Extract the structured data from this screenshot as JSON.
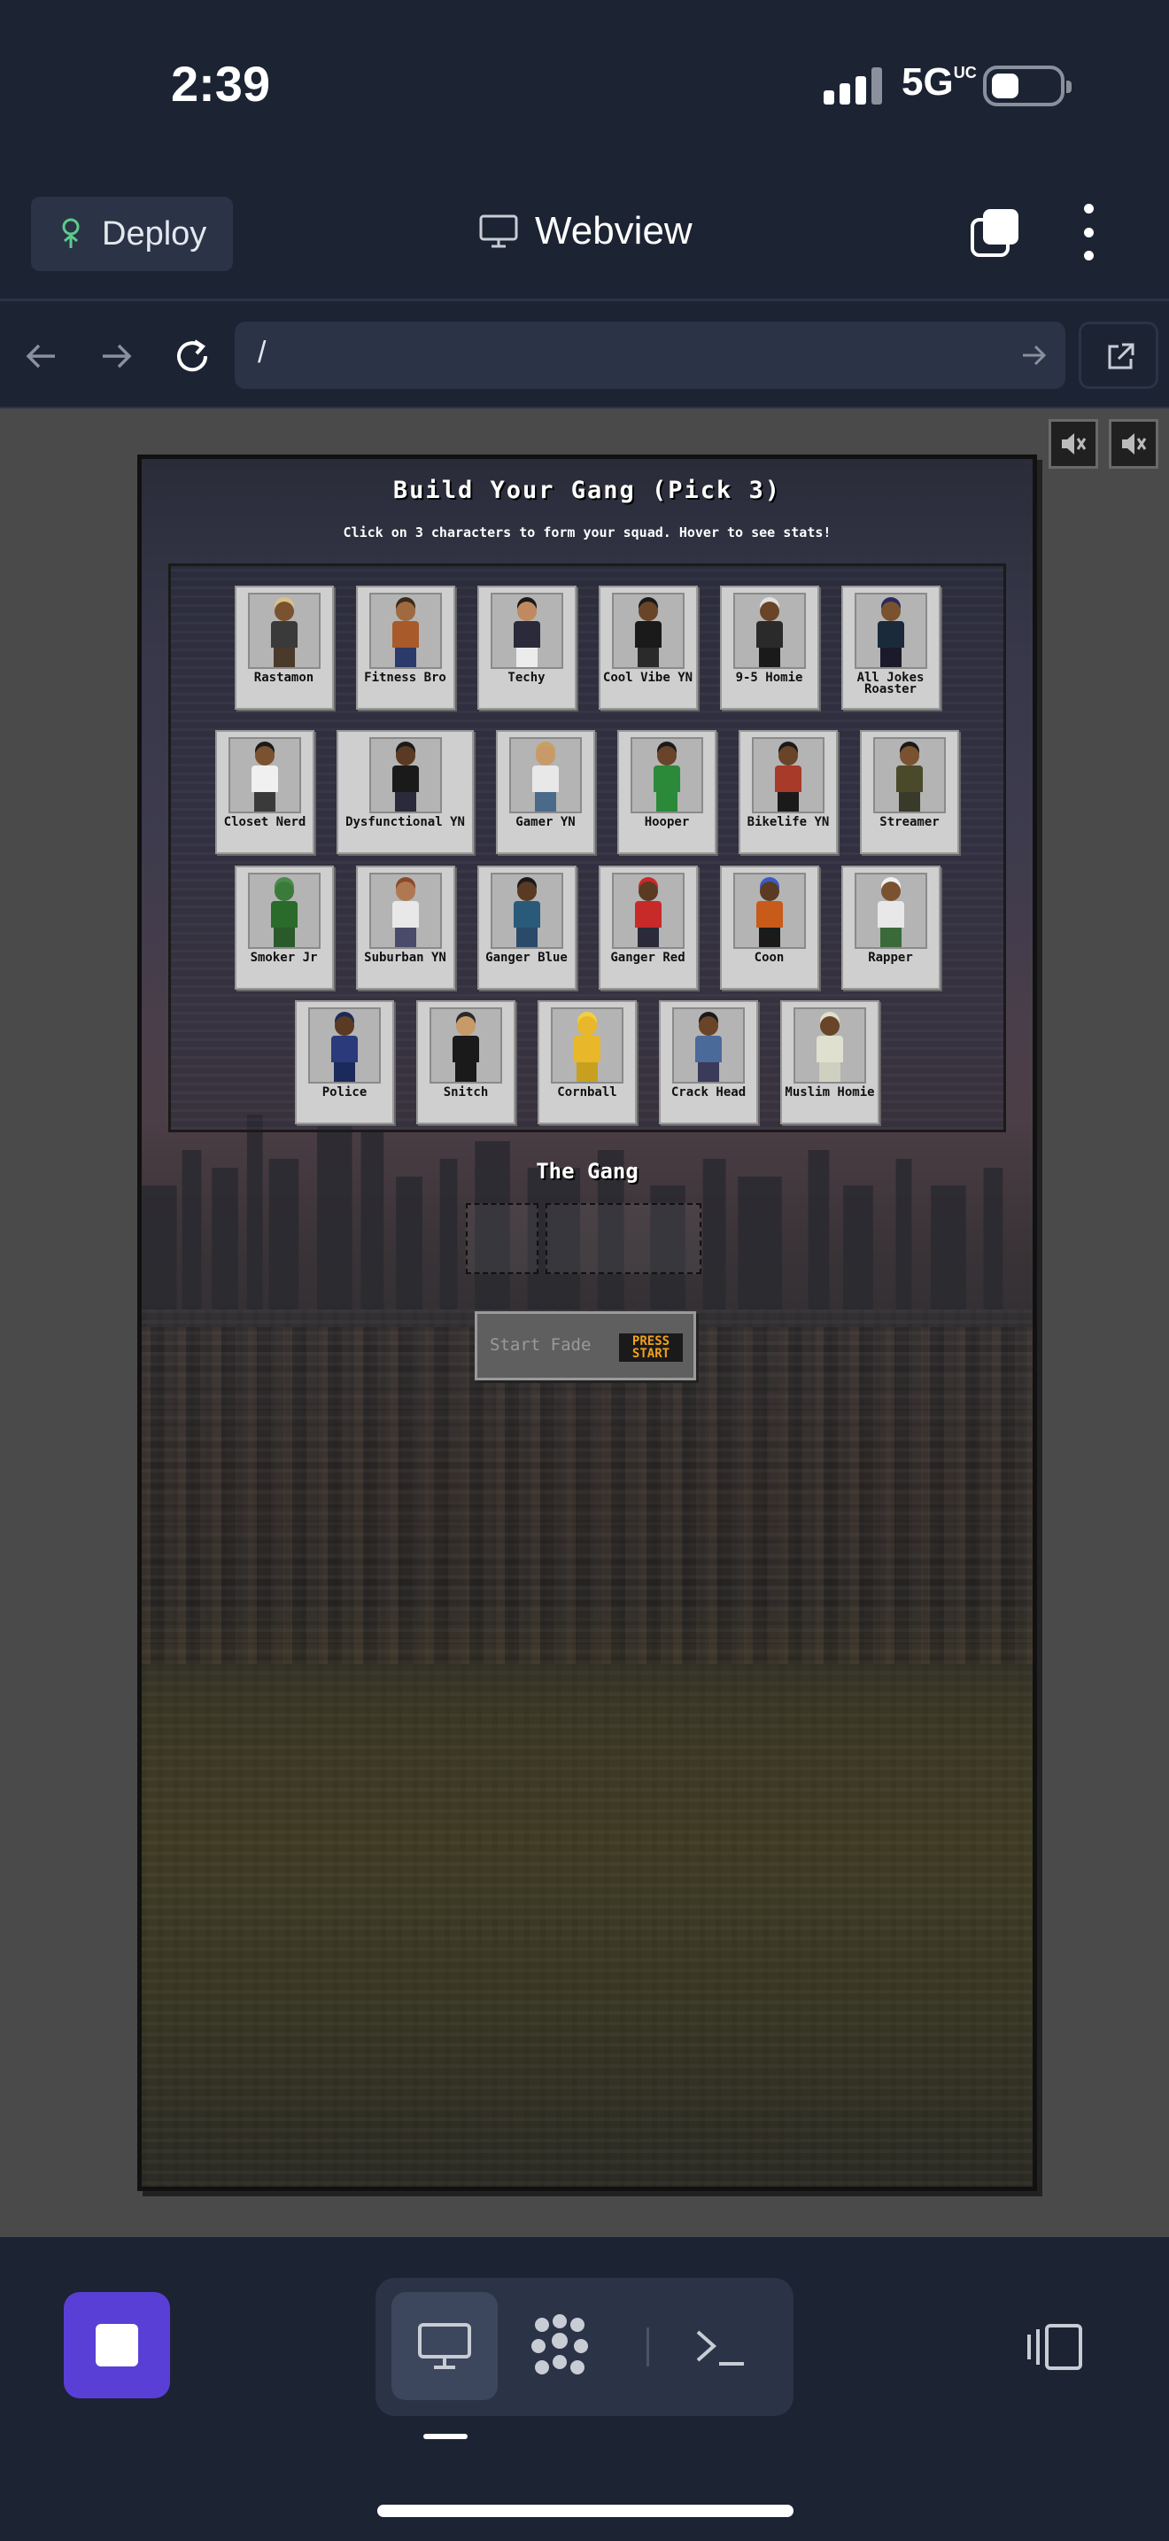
{
  "status_bar": {
    "time": "2:39",
    "network": "5G",
    "network_suffix": "UC"
  },
  "app_bar": {
    "deploy_label": "Deploy",
    "title": "Webview"
  },
  "url_bar": {
    "url": "/"
  },
  "game": {
    "title": "Build Your Gang (Pick 3)",
    "subtitle": "Click on 3 characters to form your squad. Hover to see stats!",
    "characters": [
      {
        "name": "Rastamon",
        "skin": "#7a5230",
        "shirt": "#3a3a3a",
        "pants": "#4a3a2a",
        "hair": "#d8c28a"
      },
      {
        "name": "Fitness Bro",
        "skin": "#a06a40",
        "shirt": "#a85a2a",
        "pants": "#2a3a6a",
        "hair": "#3a2a1a"
      },
      {
        "name": "Techy",
        "skin": "#c08a60",
        "shirt": "#2a2a3a",
        "pants": "#ececec",
        "hair": "#1a1a1a"
      },
      {
        "name": "Cool Vibe YN",
        "skin": "#6a4428",
        "shirt": "#1a1a1a",
        "pants": "#2a2a2a",
        "hair": "#1a1a1a"
      },
      {
        "name": "9-5 Homie",
        "skin": "#6a4428",
        "shirt": "#2a2a2a",
        "pants": "#1a1a1a",
        "hair": "#e0e0e0"
      },
      {
        "name": "All Jokes Roaster",
        "skin": "#7a5230",
        "shirt": "#1a2a3a",
        "pants": "#1a1a2a",
        "hair": "#2a2a5a"
      },
      {
        "name": "Closet Nerd",
        "skin": "#7a5230",
        "shirt": "#f0f0f0",
        "pants": "#3a3a3a",
        "hair": "#1a1a1a"
      },
      {
        "name": "Dysfunctional YN",
        "skin": "#5a3a22",
        "shirt": "#1a1a1a",
        "pants": "#2a2a3a",
        "hair": "#1a1a1a"
      },
      {
        "name": "Gamer YN",
        "skin": "#c89a6a",
        "shirt": "#e8e8e8",
        "pants": "#4a6a8a",
        "hair": "#c8a060"
      },
      {
        "name": "Hooper",
        "skin": "#6a4428",
        "shirt": "#2a8a3a",
        "pants": "#2a8a3a",
        "hair": "#1a1a1a"
      },
      {
        "name": "Bikelife YN",
        "skin": "#6a4428",
        "shirt": "#a83a2a",
        "pants": "#1a1a1a",
        "hair": "#1a1a1a"
      },
      {
        "name": "Streamer",
        "skin": "#7a5230",
        "shirt": "#4a4a2a",
        "pants": "#3a3a2a",
        "hair": "#1a1a1a"
      },
      {
        "name": "Smoker Jr",
        "skin": "#3a7a3a",
        "shirt": "#2a6a2a",
        "pants": "#2a5a2a",
        "hair": "#4a8a4a"
      },
      {
        "name": "Suburban YN",
        "skin": "#b07850",
        "shirt": "#e8e8e8",
        "pants": "#4a4a6a",
        "hair": "#8a4a2a"
      },
      {
        "name": "Ganger Blue",
        "skin": "#5a3a22",
        "shirt": "#2a5a7a",
        "pants": "#2a4a6a",
        "hair": "#1a1a1a"
      },
      {
        "name": "Ganger Red",
        "skin": "#5a3a22",
        "shirt": "#c82a2a",
        "pants": "#2a2a3a",
        "hair": "#c82a2a"
      },
      {
        "name": "Coon",
        "skin": "#5a3a22",
        "shirt": "#c85a1a",
        "pants": "#1a1a1a",
        "hair": "#3a5ac8"
      },
      {
        "name": "Rapper",
        "skin": "#7a5230",
        "shirt": "#e8e8e8",
        "pants": "#3a6a3a",
        "hair": "#f0f0f0"
      },
      {
        "name": "Police",
        "skin": "#5a3a22",
        "shirt": "#2a3a7a",
        "pants": "#1a2a5a",
        "hair": "#1a2a5a"
      },
      {
        "name": "Snitch",
        "skin": "#c89a6a",
        "shirt": "#1a1a1a",
        "pants": "#1a1a1a",
        "hair": "#2a2a2a"
      },
      {
        "name": "Cornball",
        "skin": "#e8b82a",
        "shirt": "#e8b82a",
        "pants": "#c8a020",
        "hair": "#f0d040"
      },
      {
        "name": "Crack Head",
        "skin": "#6a4428",
        "shirt": "#4a6a9a",
        "pants": "#3a3a5a",
        "hair": "#1a1a1a"
      },
      {
        "name": "Muslim Homie",
        "skin": "#6a4428",
        "shirt": "#e0e0d0",
        "pants": "#d0d0c0",
        "hair": "#e0e0d0"
      }
    ],
    "gang_title": "The Gang",
    "start_label": "Start Fade",
    "press_start": "PRESS START"
  },
  "colors": {
    "accent": "#5a3fd6",
    "chrome": "#1c2333",
    "panel": "#2b3347"
  }
}
